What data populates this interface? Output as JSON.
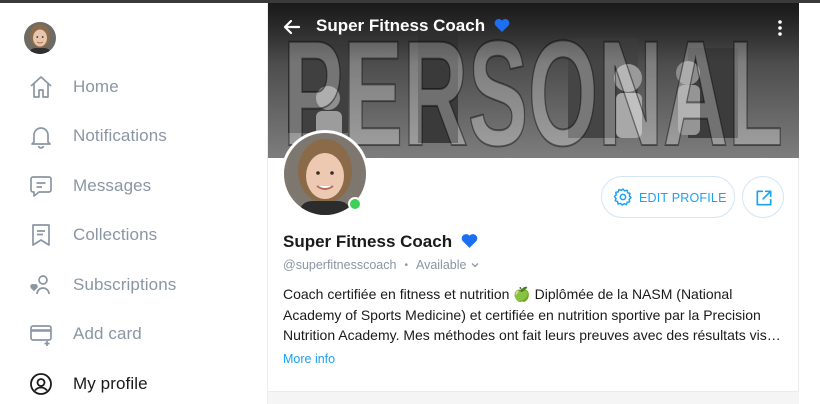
{
  "sidebar": {
    "avatar_icon": "user-avatar",
    "items": [
      {
        "label": "Home",
        "icon": "home-icon"
      },
      {
        "label": "Notifications",
        "icon": "bell-icon"
      },
      {
        "label": "Messages",
        "icon": "message-icon"
      },
      {
        "label": "Collections",
        "icon": "bookmark-icon"
      },
      {
        "label": "Subscriptions",
        "icon": "subscriptions-icon"
      },
      {
        "label": "Add card",
        "icon": "card-icon"
      },
      {
        "label": "My profile",
        "icon": "profile-icon",
        "active": true
      }
    ]
  },
  "profile": {
    "header_title": "Super Fitness Coach",
    "cover_text": "PERSONAL",
    "display_name": "Super Fitness Coach",
    "handle": "@superfitnesscoach",
    "separator": "•",
    "status": "Available",
    "edit_label": "EDIT PROFILE",
    "bio_lines": [
      "Coach certifiée en fitness et nutrition 🍏 Diplômée de la NASM (National",
      "Academy of Sports Medicine) et certifiée en nutrition sportive par la Precision",
      "Nutrition Academy. Mes méthodes ont fait leurs preuves avec des résultats vis…"
    ],
    "more_info": "More info",
    "online": true
  },
  "colors": {
    "accent": "#1da1f2",
    "muted": "#8a96a3",
    "online": "#3ed057",
    "heart": "#1d6ff2"
  }
}
